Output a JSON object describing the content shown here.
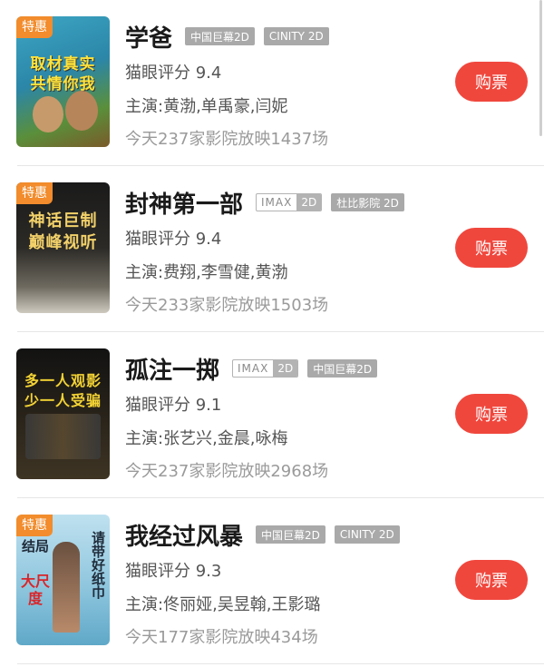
{
  "movies": [
    {
      "badge": "特惠",
      "poster_text": [
        "取材真实",
        "共情你我"
      ],
      "title": "学爸",
      "tags": [
        "中国巨幕2D",
        "CINITY 2D"
      ],
      "rating": "猫眼评分 9.4",
      "cast": "主演:黄渤,单禹豪,闫妮",
      "shows": "今天237家影院放映1437场",
      "buy_label": "购票"
    },
    {
      "badge": "特惠",
      "poster_text": [
        "神话巨制",
        "巅峰视听"
      ],
      "title": "封神第一部",
      "imax": {
        "left": "IMAX",
        "right": "2D"
      },
      "tags": [
        "杜比影院 2D"
      ],
      "rating": "猫眼评分 9.4",
      "cast": "主演:费翔,李雪健,黄渤",
      "shows": "今天233家影院放映1503场",
      "buy_label": "购票"
    },
    {
      "poster_text": [
        "多一人观影",
        "少一人受骗"
      ],
      "title": "孤注一掷",
      "imax": {
        "left": "IMAX",
        "right": "2D"
      },
      "tags": [
        "中国巨幕2D"
      ],
      "rating": "猫眼评分 9.1",
      "cast": "主演:张艺兴,金晨,咏梅",
      "shows": "今天237家影院放映2968场",
      "buy_label": "购票"
    },
    {
      "badge": "特惠",
      "poster_text": [
        "结局",
        "大尺度",
        "请带好纸巾"
      ],
      "title": "我经过风暴",
      "tags": [
        "中国巨幕2D",
        "CINITY 2D"
      ],
      "rating": "猫眼评分 9.3",
      "cast": "主演:佟丽娅,吴昱翰,王影璐",
      "shows": "今天177家影院放映434场",
      "buy_label": "购票"
    }
  ]
}
